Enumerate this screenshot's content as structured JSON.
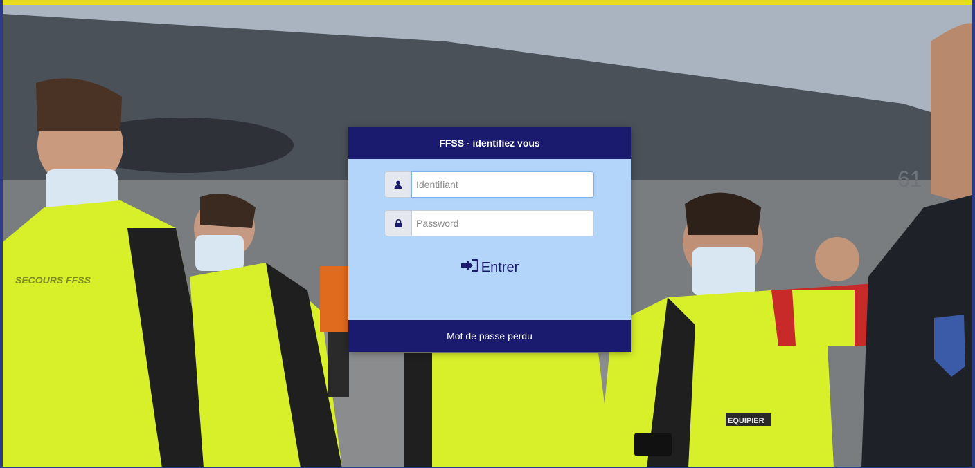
{
  "login": {
    "title": "FFSS - identifiez vous",
    "username_placeholder": "Identifiant",
    "username_value": "",
    "password_placeholder": "Password",
    "password_value": "",
    "enter_label": "Entrer",
    "lost_password_label": "Mot de passe perdu"
  },
  "background": {
    "jacket_texts": [
      "SECOURS FFSS",
      "EQUIPIER",
      "61"
    ]
  },
  "colors": {
    "accent_navy": "#1a1a6e",
    "panel_bg": "#b3d5fa",
    "top_bar": "#e6dc1e",
    "jacket_yellow": "#d7f02a"
  },
  "icons": {
    "username": "user-icon",
    "password": "lock-icon",
    "enter": "sign-in-icon"
  }
}
